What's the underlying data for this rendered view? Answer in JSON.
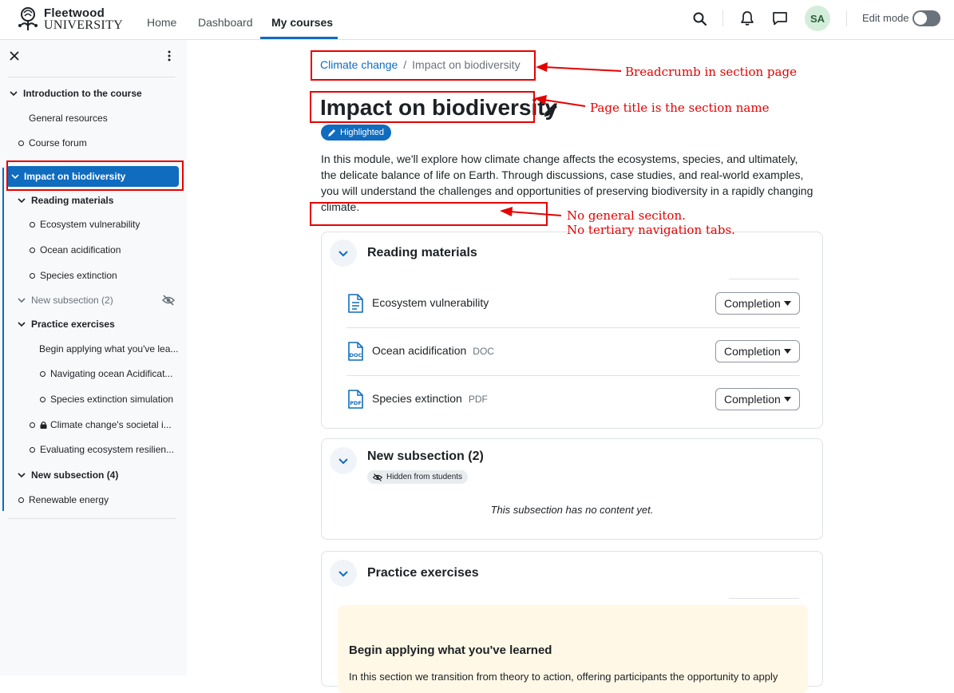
{
  "brand": {
    "line1": "Fleetwood",
    "line2": "UNIVERSITY"
  },
  "nav": {
    "home": "Home",
    "dashboard": "Dashboard",
    "my_courses": "My courses"
  },
  "user": {
    "initials": "SA"
  },
  "edit_mode": {
    "label": "Edit mode",
    "enabled": false
  },
  "course_index": {
    "items": [
      {
        "label": "Introduction to the course"
      },
      {
        "label": "General resources"
      },
      {
        "label": "Course forum"
      },
      {
        "label": "Impact on biodiversity"
      },
      {
        "label": "Reading materials"
      },
      {
        "label": "Ecosystem vulnerability"
      },
      {
        "label": "Ocean acidification"
      },
      {
        "label": "Species extinction"
      },
      {
        "label": "New subsection (2)"
      },
      {
        "label": "Practice exercises"
      },
      {
        "label": "Begin applying what you've lea..."
      },
      {
        "label": "Navigating ocean Acidificat..."
      },
      {
        "label": "Species extinction simulation"
      },
      {
        "label": "Climate change's societal i..."
      },
      {
        "label": "Evaluating ecosystem resilien..."
      },
      {
        "label": "New subsection (4)"
      },
      {
        "label": "Renewable energy"
      }
    ]
  },
  "breadcrumb": {
    "course": "Climate change",
    "separator": "/",
    "current": "Impact on biodiversity"
  },
  "section": {
    "title": "Impact on biodiversity",
    "badge": "Highlighted",
    "summary": "In this module, we'll explore how climate change affects the ecosystems, species, and ultimately, the delicate balance of life on Earth. Through discussions, case studies, and real-world examples, you will understand the challenges and opportunities of preserving biodiversity in a rapidly changing climate."
  },
  "subsections": [
    {
      "title": "Reading materials",
      "activities": [
        {
          "name": "Ecosystem vulnerability",
          "type": "",
          "icon": "page-icon",
          "completion": "Completion"
        },
        {
          "name": "Ocean acidification",
          "type": "DOC",
          "icon": "doc-file-icon",
          "completion": "Completion"
        },
        {
          "name": "Species extinction",
          "type": "PDF",
          "icon": "pdf-file-icon",
          "completion": "Completion"
        }
      ]
    },
    {
      "title": "New subsection (2)",
      "badge": "Hidden from students",
      "empty_message": "This subsection has no content yet."
    },
    {
      "title": "Practice exercises",
      "label_title": "Begin applying what you've learned",
      "label_text": "In this section we transition from theory to action, offering participants the opportunity to apply"
    }
  ],
  "annotations": {
    "breadcrumb": "Breadcrumb in section page",
    "title": "Page title is the section name",
    "general_line1": "No general seciton.",
    "general_line2": "No tertiary navigation tabs."
  },
  "colors": {
    "primary": "#0f6cbf",
    "annotation": "#e60000",
    "label_bg": "#fff8e6"
  }
}
